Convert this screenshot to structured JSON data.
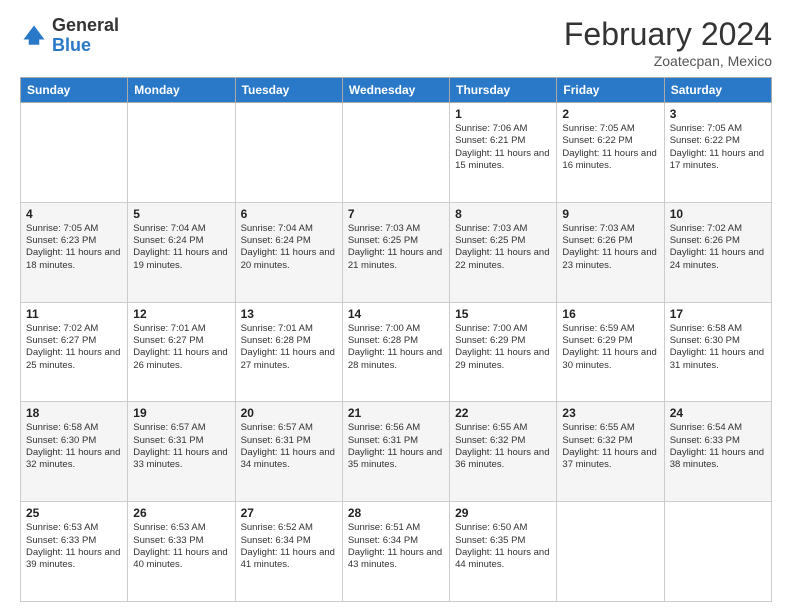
{
  "header": {
    "logo": {
      "general": "General",
      "blue": "Blue"
    },
    "title": "February 2024",
    "location": "Zoatecpan, Mexico"
  },
  "days_of_week": [
    "Sunday",
    "Monday",
    "Tuesday",
    "Wednesday",
    "Thursday",
    "Friday",
    "Saturday"
  ],
  "weeks": [
    [
      {
        "day": "",
        "info": ""
      },
      {
        "day": "",
        "info": ""
      },
      {
        "day": "",
        "info": ""
      },
      {
        "day": "",
        "info": ""
      },
      {
        "day": "1",
        "info": "Sunrise: 7:06 AM\nSunset: 6:21 PM\nDaylight: 11 hours and 15 minutes."
      },
      {
        "day": "2",
        "info": "Sunrise: 7:05 AM\nSunset: 6:22 PM\nDaylight: 11 hours and 16 minutes."
      },
      {
        "day": "3",
        "info": "Sunrise: 7:05 AM\nSunset: 6:22 PM\nDaylight: 11 hours and 17 minutes."
      }
    ],
    [
      {
        "day": "4",
        "info": "Sunrise: 7:05 AM\nSunset: 6:23 PM\nDaylight: 11 hours and 18 minutes."
      },
      {
        "day": "5",
        "info": "Sunrise: 7:04 AM\nSunset: 6:24 PM\nDaylight: 11 hours and 19 minutes."
      },
      {
        "day": "6",
        "info": "Sunrise: 7:04 AM\nSunset: 6:24 PM\nDaylight: 11 hours and 20 minutes."
      },
      {
        "day": "7",
        "info": "Sunrise: 7:03 AM\nSunset: 6:25 PM\nDaylight: 11 hours and 21 minutes."
      },
      {
        "day": "8",
        "info": "Sunrise: 7:03 AM\nSunset: 6:25 PM\nDaylight: 11 hours and 22 minutes."
      },
      {
        "day": "9",
        "info": "Sunrise: 7:03 AM\nSunset: 6:26 PM\nDaylight: 11 hours and 23 minutes."
      },
      {
        "day": "10",
        "info": "Sunrise: 7:02 AM\nSunset: 6:26 PM\nDaylight: 11 hours and 24 minutes."
      }
    ],
    [
      {
        "day": "11",
        "info": "Sunrise: 7:02 AM\nSunset: 6:27 PM\nDaylight: 11 hours and 25 minutes."
      },
      {
        "day": "12",
        "info": "Sunrise: 7:01 AM\nSunset: 6:27 PM\nDaylight: 11 hours and 26 minutes."
      },
      {
        "day": "13",
        "info": "Sunrise: 7:01 AM\nSunset: 6:28 PM\nDaylight: 11 hours and 27 minutes."
      },
      {
        "day": "14",
        "info": "Sunrise: 7:00 AM\nSunset: 6:28 PM\nDaylight: 11 hours and 28 minutes."
      },
      {
        "day": "15",
        "info": "Sunrise: 7:00 AM\nSunset: 6:29 PM\nDaylight: 11 hours and 29 minutes."
      },
      {
        "day": "16",
        "info": "Sunrise: 6:59 AM\nSunset: 6:29 PM\nDaylight: 11 hours and 30 minutes."
      },
      {
        "day": "17",
        "info": "Sunrise: 6:58 AM\nSunset: 6:30 PM\nDaylight: 11 hours and 31 minutes."
      }
    ],
    [
      {
        "day": "18",
        "info": "Sunrise: 6:58 AM\nSunset: 6:30 PM\nDaylight: 11 hours and 32 minutes."
      },
      {
        "day": "19",
        "info": "Sunrise: 6:57 AM\nSunset: 6:31 PM\nDaylight: 11 hours and 33 minutes."
      },
      {
        "day": "20",
        "info": "Sunrise: 6:57 AM\nSunset: 6:31 PM\nDaylight: 11 hours and 34 minutes."
      },
      {
        "day": "21",
        "info": "Sunrise: 6:56 AM\nSunset: 6:31 PM\nDaylight: 11 hours and 35 minutes."
      },
      {
        "day": "22",
        "info": "Sunrise: 6:55 AM\nSunset: 6:32 PM\nDaylight: 11 hours and 36 minutes."
      },
      {
        "day": "23",
        "info": "Sunrise: 6:55 AM\nSunset: 6:32 PM\nDaylight: 11 hours and 37 minutes."
      },
      {
        "day": "24",
        "info": "Sunrise: 6:54 AM\nSunset: 6:33 PM\nDaylight: 11 hours and 38 minutes."
      }
    ],
    [
      {
        "day": "25",
        "info": "Sunrise: 6:53 AM\nSunset: 6:33 PM\nDaylight: 11 hours and 39 minutes."
      },
      {
        "day": "26",
        "info": "Sunrise: 6:53 AM\nSunset: 6:33 PM\nDaylight: 11 hours and 40 minutes."
      },
      {
        "day": "27",
        "info": "Sunrise: 6:52 AM\nSunset: 6:34 PM\nDaylight: 11 hours and 41 minutes."
      },
      {
        "day": "28",
        "info": "Sunrise: 6:51 AM\nSunset: 6:34 PM\nDaylight: 11 hours and 43 minutes."
      },
      {
        "day": "29",
        "info": "Sunrise: 6:50 AM\nSunset: 6:35 PM\nDaylight: 11 hours and 44 minutes."
      },
      {
        "day": "",
        "info": ""
      },
      {
        "day": "",
        "info": ""
      }
    ]
  ]
}
